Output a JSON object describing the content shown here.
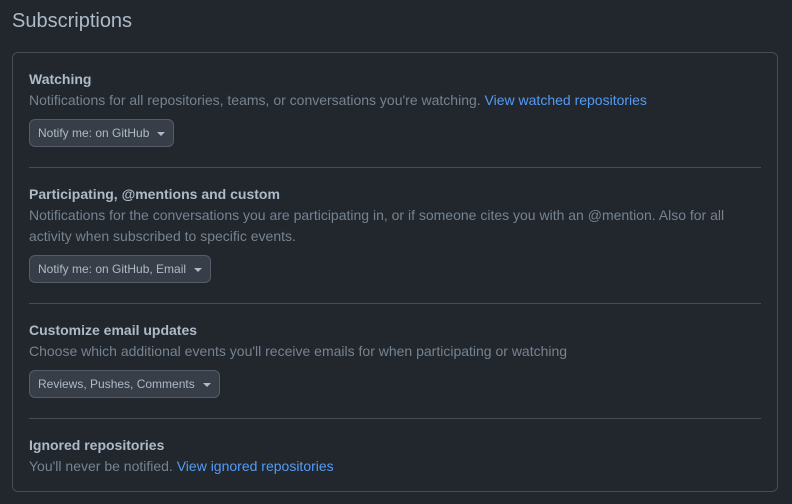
{
  "page": {
    "title": "Subscriptions"
  },
  "sections": [
    {
      "title": "Watching",
      "description": "Notifications for all repositories, teams, or conversations you're watching.",
      "link": "View watched repositories",
      "select": "Notify me: on GitHub"
    },
    {
      "title": "Participating, @mentions and custom",
      "description": "Notifications for the conversations you are participating in, or if someone cites you with an @mention. Also for all activity when subscribed to specific events.",
      "select": "Notify me: on GitHub, Email"
    },
    {
      "title": "Customize email updates",
      "description": "Choose which additional events you'll receive emails for when participating or watching",
      "select": "Reviews, Pushes, Comments"
    },
    {
      "title": "Ignored repositories",
      "description": "You'll never be notified.",
      "link": "View ignored repositories"
    }
  ],
  "colors": {
    "background": "#22272e",
    "border": "#444c56",
    "text": "#adbac7",
    "muted": "#768390",
    "link": "#539bf5"
  },
  "icons": {
    "select_caret": "caret-down-icon"
  }
}
